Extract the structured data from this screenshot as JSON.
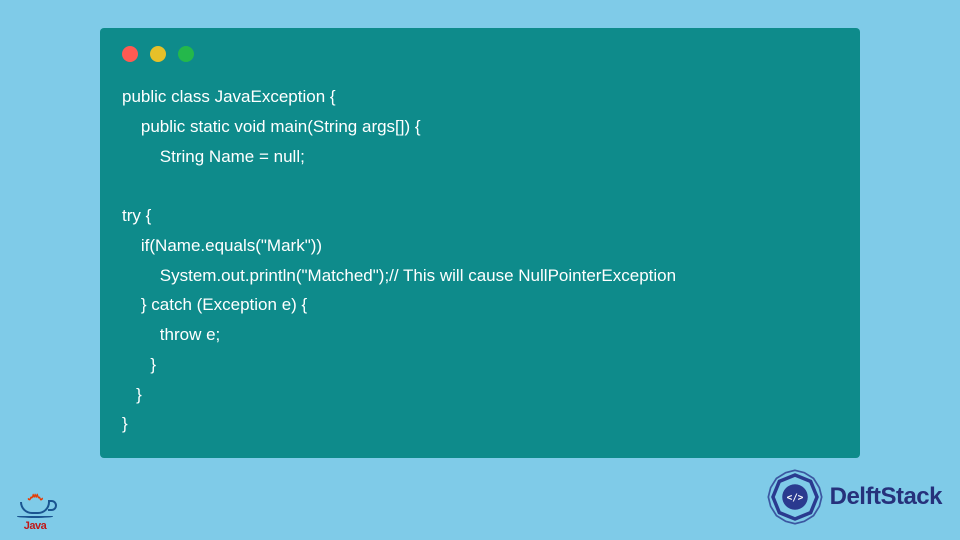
{
  "code": {
    "lines": [
      "public class JavaException {",
      "    public static void main(String args[]) {",
      "        String Name = null;",
      "",
      "try {",
      "    if(Name.equals(\"Mark\"))",
      "        System.out.println(\"Matched\");// This will cause NullPointerException",
      "    } catch (Exception e) {",
      "        throw e;",
      "      }",
      "   }",
      "}"
    ]
  },
  "logos": {
    "java_label": "Java",
    "delft_label": "DelftStack",
    "delft_badge_text": "</>"
  },
  "traffic": {
    "red": "#ff5a52",
    "yellow": "#e6c029",
    "green": "#24b84b"
  }
}
